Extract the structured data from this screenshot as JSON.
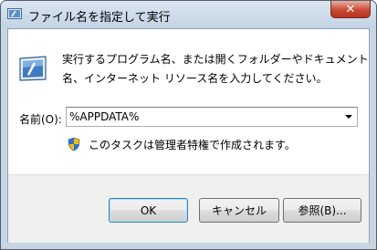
{
  "window": {
    "title": "ファイル名を指定して実行",
    "close_glyph": "✕"
  },
  "dialog": {
    "description_line1": "実行するプログラム名、または開くフォルダーやドキュメント",
    "description_line2": "名、インターネット リソース名を入力してください。",
    "open_label": "名前(O):",
    "open_value": "%APPDATA%",
    "admin_note": "このタスクは管理者特権で作成されます。"
  },
  "buttons": {
    "ok": "OK",
    "cancel": "キャンセル",
    "browse": "参照(B)..."
  },
  "icons": {
    "title": "run-app-icon",
    "main": "run-app-icon",
    "admin": "uac-shield-icon",
    "close": "close-icon",
    "dropdown": "chevron-down-icon"
  }
}
